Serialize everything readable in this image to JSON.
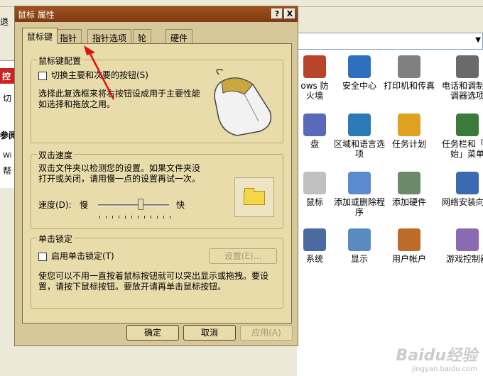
{
  "dialog": {
    "title": "鼠标 属性",
    "help_btn": "?",
    "close_btn": "X",
    "tabs": [
      {
        "label": "鼠标键"
      },
      {
        "label": "指针"
      },
      {
        "label": "指针选项"
      },
      {
        "label": "轮"
      },
      {
        "label": "硬件"
      }
    ],
    "button_config": {
      "title": "鼠标键配置",
      "checkbox_label": "切换主要和次要的按钮(S)",
      "desc1": "选择此复选框来将右按钮设成用于主要性能",
      "desc2": "如选择和拖放之用。"
    },
    "double_click": {
      "title": "双击速度",
      "desc1": "双击文件夹以检测您的设置。如果文件夹没",
      "desc2": "打开或关闭，请用慢一点的设置再试一次。",
      "speed_label": "速度(D):",
      "slow": "慢",
      "fast": "快",
      "speed_value": 0.6
    },
    "click_lock": {
      "title": "单击锁定",
      "checkbox_label": "启用单击锁定(T)",
      "settings_btn": "设置(E)...",
      "desc1": "使您可以不用一直按着鼠标按钮就可以突出显示或拖拽。要设",
      "desc2": "置，请按下鼠标按钮。要放开请再单击鼠标按钮。"
    },
    "ok": "确定",
    "cancel": "取消",
    "apply": "应用(A)"
  },
  "background": {
    "left_fragments": [
      "退",
      "控",
      "切",
      "参阅",
      "Wi",
      "帮"
    ],
    "control_panel_items": [
      {
        "label": "ows 防火墙",
        "color": "#b8442a"
      },
      {
        "label": "安全中心",
        "color": "#2e6fbe"
      },
      {
        "label": "打印机和传真",
        "color": "#808080"
      },
      {
        "label": "电话和调制解调器选项",
        "color": "#6a6a6a"
      },
      {
        "label": "盘",
        "color": "#5a6ab8"
      },
      {
        "label": "区域和语言选项",
        "color": "#2a7ab8"
      },
      {
        "label": "任务计划",
        "color": "#e0a020"
      },
      {
        "label": "任务栏和「开始」菜单",
        "color": "#3a7a3a"
      },
      {
        "label": "鼠标",
        "color": "#c0c0c0"
      },
      {
        "label": "添加或删除程序",
        "color": "#5a8ad0"
      },
      {
        "label": "添加硬件",
        "color": "#6a8a6a"
      },
      {
        "label": "网络安装向导",
        "color": "#3a6ab0"
      },
      {
        "label": "系统",
        "color": "#4a6aa0"
      },
      {
        "label": "显示",
        "color": "#5a8ac0"
      },
      {
        "label": "用户帐户",
        "color": "#c06a2a"
      },
      {
        "label": "游戏控制器",
        "color": "#8a6ab0"
      }
    ],
    "watermark": "Baidu经验",
    "watermark_sub": "jingyan.baidu.com"
  }
}
